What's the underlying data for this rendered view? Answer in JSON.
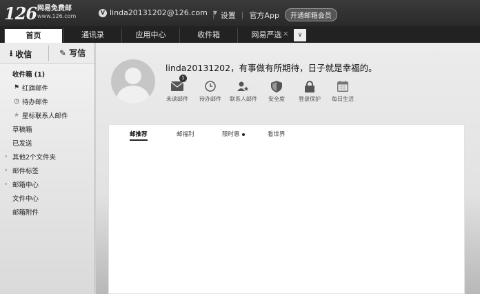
{
  "logo": {
    "number": "126",
    "title": "网易免费邮",
    "domain": "www.126.com"
  },
  "account": {
    "badge": "V",
    "email": "linda20131202@126.com"
  },
  "top_links": [
    "设置",
    "官方App"
  ],
  "vip_button": "开通邮箱会员",
  "tabs": [
    "首页",
    "通讯录",
    "应用中心",
    "收件箱",
    "网易严选"
  ],
  "tab_close": "×",
  "tab_more": "∨",
  "sidebar": {
    "receive": "收信",
    "write": "写信",
    "nav": [
      "收件箱 (1)",
      "红旗邮件",
      "待办邮件",
      "星标联系人邮件",
      "草稿箱",
      "已发送",
      "其他2个文件夹",
      "邮件标签",
      "邮箱中心",
      "文件中心",
      "邮箱附件"
    ]
  },
  "main": {
    "greeting": "linda20131202，有事做有所期待，日子就是幸福的。",
    "quick_links": [
      {
        "label": "未读邮件",
        "icon": "envelope-icon",
        "badge": "1"
      },
      {
        "label": "待办邮件",
        "icon": "clock-icon"
      },
      {
        "label": "联系人邮件",
        "icon": "contact-star-icon"
      },
      {
        "label": "安全度",
        "icon": "shield-icon"
      },
      {
        "label": "登录保护",
        "icon": "lock-icon"
      },
      {
        "label": "每日生活",
        "icon": "calendar-icon"
      }
    ],
    "panel_tabs": [
      "邮推荐",
      "邮福利",
      "限时惠",
      "看世界"
    ]
  },
  "colors": {
    "topbar": "#2f2f2f",
    "tabsbar": "#222222",
    "active_tab": "#ffffff"
  }
}
